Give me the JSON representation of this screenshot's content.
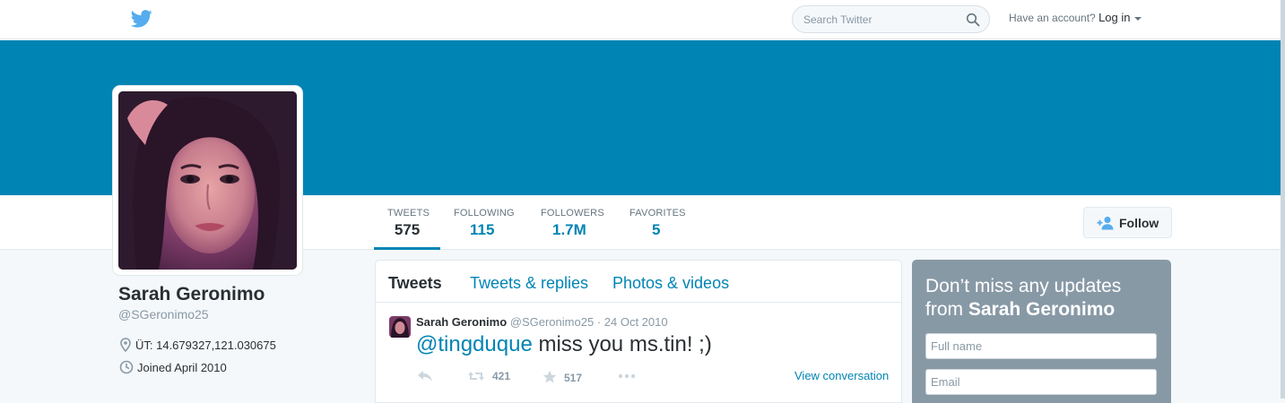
{
  "topnav": {
    "search_placeholder": "Search Twitter",
    "account_prompt": "Have an account?",
    "login_label": "Log in"
  },
  "colors": {
    "brand": "#55acee",
    "link": "#0084b4",
    "banner": "#0084b4",
    "signup_bg": "#8899a6"
  },
  "profile": {
    "name": "Sarah Geronimo",
    "handle": "@SGeronimo25",
    "location": "ÜT: 14.679327,121.030675",
    "joined": "Joined April 2010"
  },
  "stats": [
    {
      "label": "TWEETS",
      "value": "575"
    },
    {
      "label": "FOLLOWING",
      "value": "115"
    },
    {
      "label": "FOLLOWERS",
      "value": "1.7M"
    },
    {
      "label": "FAVORITES",
      "value": "5"
    }
  ],
  "follow_label": "Follow",
  "timeline": {
    "tabs": [
      "Tweets",
      "Tweets & replies",
      "Photos & videos"
    ],
    "tweet": {
      "name": "Sarah Geronimo",
      "handle": "@SGeronimo25",
      "separator": "·",
      "date": "24 Oct 2010",
      "mention": "@tingduque",
      "text": " miss you ms.tin! ;)",
      "retweets": "421",
      "favorites": "517",
      "view_conversation": "View conversation"
    }
  },
  "signup": {
    "title_prefix": "Don’t miss any updates from ",
    "title_name": "Sarah Geronimo",
    "fullname_placeholder": "Full name",
    "email_placeholder": "Email"
  },
  "icons": {
    "logo": "twitter-bird-icon",
    "search": "search-icon",
    "follow": "add-person-icon",
    "location": "map-pin-icon",
    "joined": "clock-icon",
    "reply": "reply-icon",
    "retweet": "retweet-icon",
    "favorite": "star-icon",
    "more": "more-dots-icon"
  }
}
